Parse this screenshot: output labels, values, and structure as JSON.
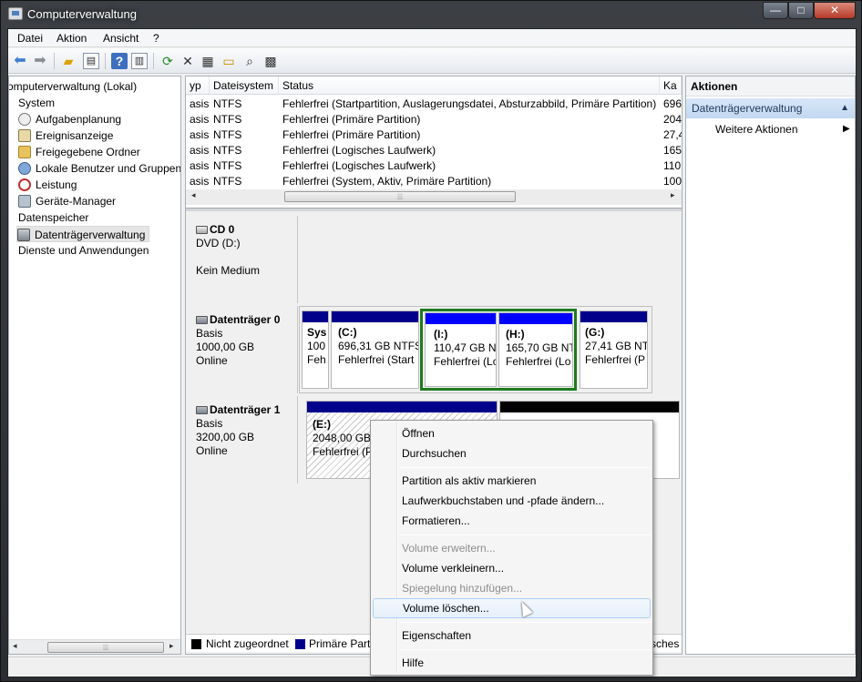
{
  "window": {
    "title": "Computerverwaltung",
    "controls": {
      "minimize": "—",
      "maximize": "□",
      "close": "✕"
    }
  },
  "menu": [
    "Datei",
    "Aktion",
    "Ansicht",
    "?"
  ],
  "toolbar": {
    "icons": [
      "back-arrow-icon",
      "forward-arrow-icon",
      "up-folder-icon",
      "show-hide-tree-icon",
      "help-icon",
      "view-icon",
      "refresh-icon",
      "delete-icon",
      "properties-icon",
      "open-icon",
      "search-icon",
      "settings-icon"
    ]
  },
  "tree": {
    "items": [
      {
        "label": "omputerverwaltung (Lokal)",
        "level": 0
      },
      {
        "label": "System",
        "level": 1
      },
      {
        "label": "Aufgabenplanung",
        "level": 2
      },
      {
        "label": "Ereignisanzeige",
        "level": 2
      },
      {
        "label": "Freigegebene Ordner",
        "level": 2
      },
      {
        "label": "Lokale Benutzer und Gruppen",
        "level": 2
      },
      {
        "label": "Leistung",
        "level": 2
      },
      {
        "label": "Geräte-Manager",
        "level": 2
      },
      {
        "label": "Datenspeicher",
        "level": 1
      },
      {
        "label": "Datenträgerverwaltung",
        "level": 2,
        "selected": true
      },
      {
        "label": "Dienste und Anwendungen",
        "level": 1
      }
    ]
  },
  "volumes": {
    "columns": [
      "yp",
      "Dateisystem",
      "Status",
      "Ka"
    ],
    "rows": [
      [
        "asis",
        "NTFS",
        "Fehlerfrei (Startpartition, Auslagerungsdatei, Absturzabbild, Primäre Partition)",
        "696"
      ],
      [
        "asis",
        "NTFS",
        "Fehlerfrei (Primäre Partition)",
        "204"
      ],
      [
        "asis",
        "NTFS",
        "Fehlerfrei (Primäre Partition)",
        "27,4"
      ],
      [
        "asis",
        "NTFS",
        "Fehlerfrei (Logisches Laufwerk)",
        "165"
      ],
      [
        "asis",
        "NTFS",
        "Fehlerfrei (Logisches Laufwerk)",
        "110"
      ],
      [
        "asis",
        "NTFS",
        "Fehlerfrei (System, Aktiv, Primäre Partition)",
        "100"
      ]
    ]
  },
  "disks": [
    {
      "name": "CD 0",
      "line1": "DVD (D:)",
      "line2": "",
      "line3": "Kein Medium"
    },
    {
      "name": "Datenträger 0",
      "line1": "Basis",
      "line2": "1000,00 GB",
      "line3": "Online"
    },
    {
      "name": "Datenträger 1",
      "line1": "Basis",
      "line2": "3200,00 GB",
      "line3": "Online"
    }
  ],
  "partitions_disk0": [
    {
      "name": "Sys",
      "size": "100",
      "status": "Feh"
    },
    {
      "name": "(C:)",
      "size": "696,31 GB NTFS",
      "status": "Fehlerfrei (Start"
    },
    {
      "name": "(I:)",
      "size": "110,47 GB N",
      "status": "Fehlerfrei (Lc"
    },
    {
      "name": "(H:)",
      "size": "165,70 GB NT",
      "status": "Fehlerfrei (Lo"
    },
    {
      "name": "(G:)",
      "size": "27,41 GB NT",
      "status": "Fehlerfrei (P"
    }
  ],
  "partitions_disk1": [
    {
      "name": "(E:)",
      "size": "2048,00 GB NT",
      "status": "Fehlerfrei (Pri"
    }
  ],
  "legend": [
    {
      "label": "Nicht zugeordnet",
      "color": "#000000"
    },
    {
      "label": "Primäre Parti",
      "color": "#00008b"
    },
    {
      "label": "sches",
      "color": ""
    }
  ],
  "actions": {
    "header": "Aktionen",
    "section": "Datenträgerverwaltung",
    "item": "Weitere Aktionen"
  },
  "context_menu": {
    "items": [
      {
        "label": "Öffnen",
        "disabled": false
      },
      {
        "label": "Durchsuchen",
        "disabled": false
      },
      {
        "label": "Partition als aktiv markieren",
        "disabled": false
      },
      {
        "label": "Laufwerkbuchstaben und -pfade ändern...",
        "disabled": false
      },
      {
        "label": "Formatieren...",
        "disabled": false
      },
      {
        "label": "Volume erweitern...",
        "disabled": true
      },
      {
        "label": "Volume verkleinern...",
        "disabled": false
      },
      {
        "label": "Spiegelung hinzufügen...",
        "disabled": true
      },
      {
        "label": "Volume löschen...",
        "disabled": false,
        "hover": true
      },
      {
        "label": "Eigenschaften",
        "disabled": false
      },
      {
        "label": "Hilfe",
        "disabled": false
      }
    ]
  },
  "colors": {
    "primary_partition": "#00008b",
    "logical_drive": "#0000ff",
    "unallocated": "#000000",
    "selection": "#1f7a1f"
  }
}
